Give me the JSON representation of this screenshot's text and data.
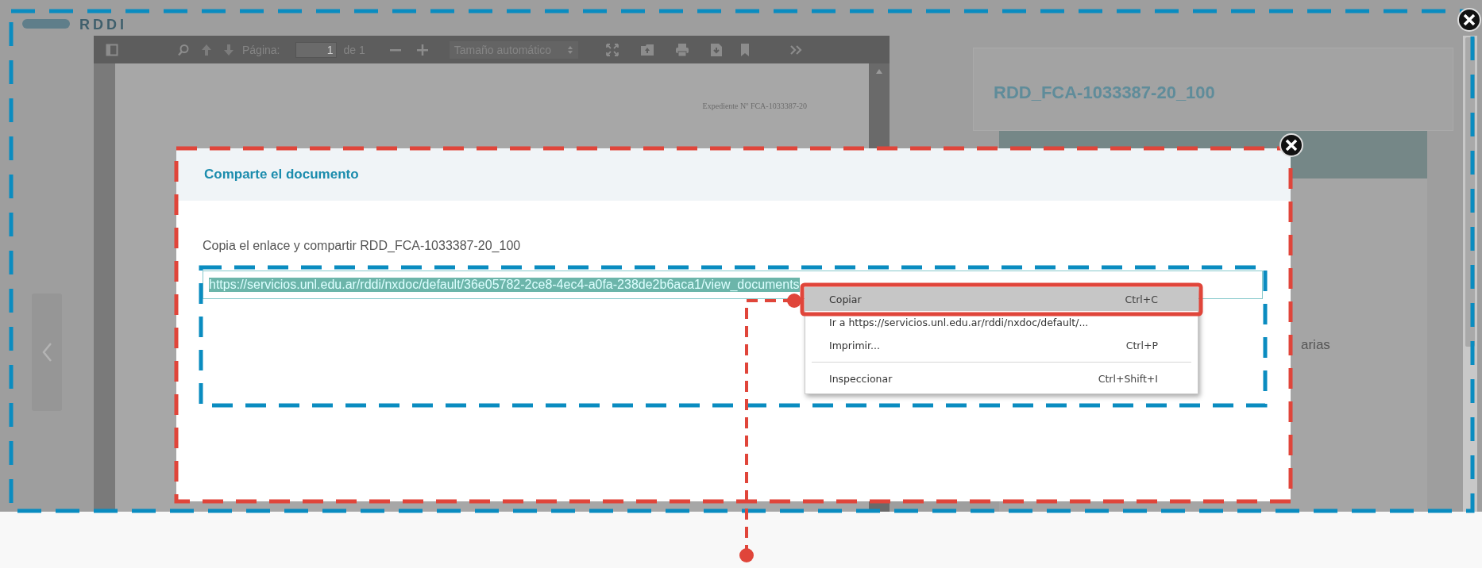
{
  "logo": {
    "text": "RDDI"
  },
  "viewer": {
    "toolbar": {
      "page_label": "Página:",
      "page_value": "1",
      "page_total": "de 1",
      "zoom_select": "Tamaño automático"
    },
    "document": {
      "header_text": "Expediente Nº FCA-1033387-20"
    }
  },
  "side_panel": {
    "title": "RDD_FCA-1033387-20_100",
    "partial_text": "arias"
  },
  "dialog": {
    "title": "Comparte el documento",
    "instruction": "Copia el enlace y compartir RDD_FCA-1033387-20_100",
    "link_value": "https://servicios.unl.edu.ar/rddi/nxdoc/default/36e05782-2ce8-4ec4-a0fa-238de2b6aca1/view_documents",
    "link_selected": true
  },
  "context_menu": {
    "items": [
      {
        "kind": "item",
        "label": "Copiar",
        "shortcut": "Ctrl+C",
        "selected": true
      },
      {
        "kind": "item",
        "label": "Ir a https://servicios.unl.edu.ar/rddi/nxdoc/default/...",
        "selected": false
      },
      {
        "kind": "item",
        "label": "Imprimir...",
        "shortcut": "Ctrl+P",
        "selected": false
      },
      {
        "kind": "separator"
      },
      {
        "kind": "item",
        "label": "Inspeccionar",
        "shortcut": "Ctrl+Shift+I",
        "selected": false
      }
    ]
  }
}
